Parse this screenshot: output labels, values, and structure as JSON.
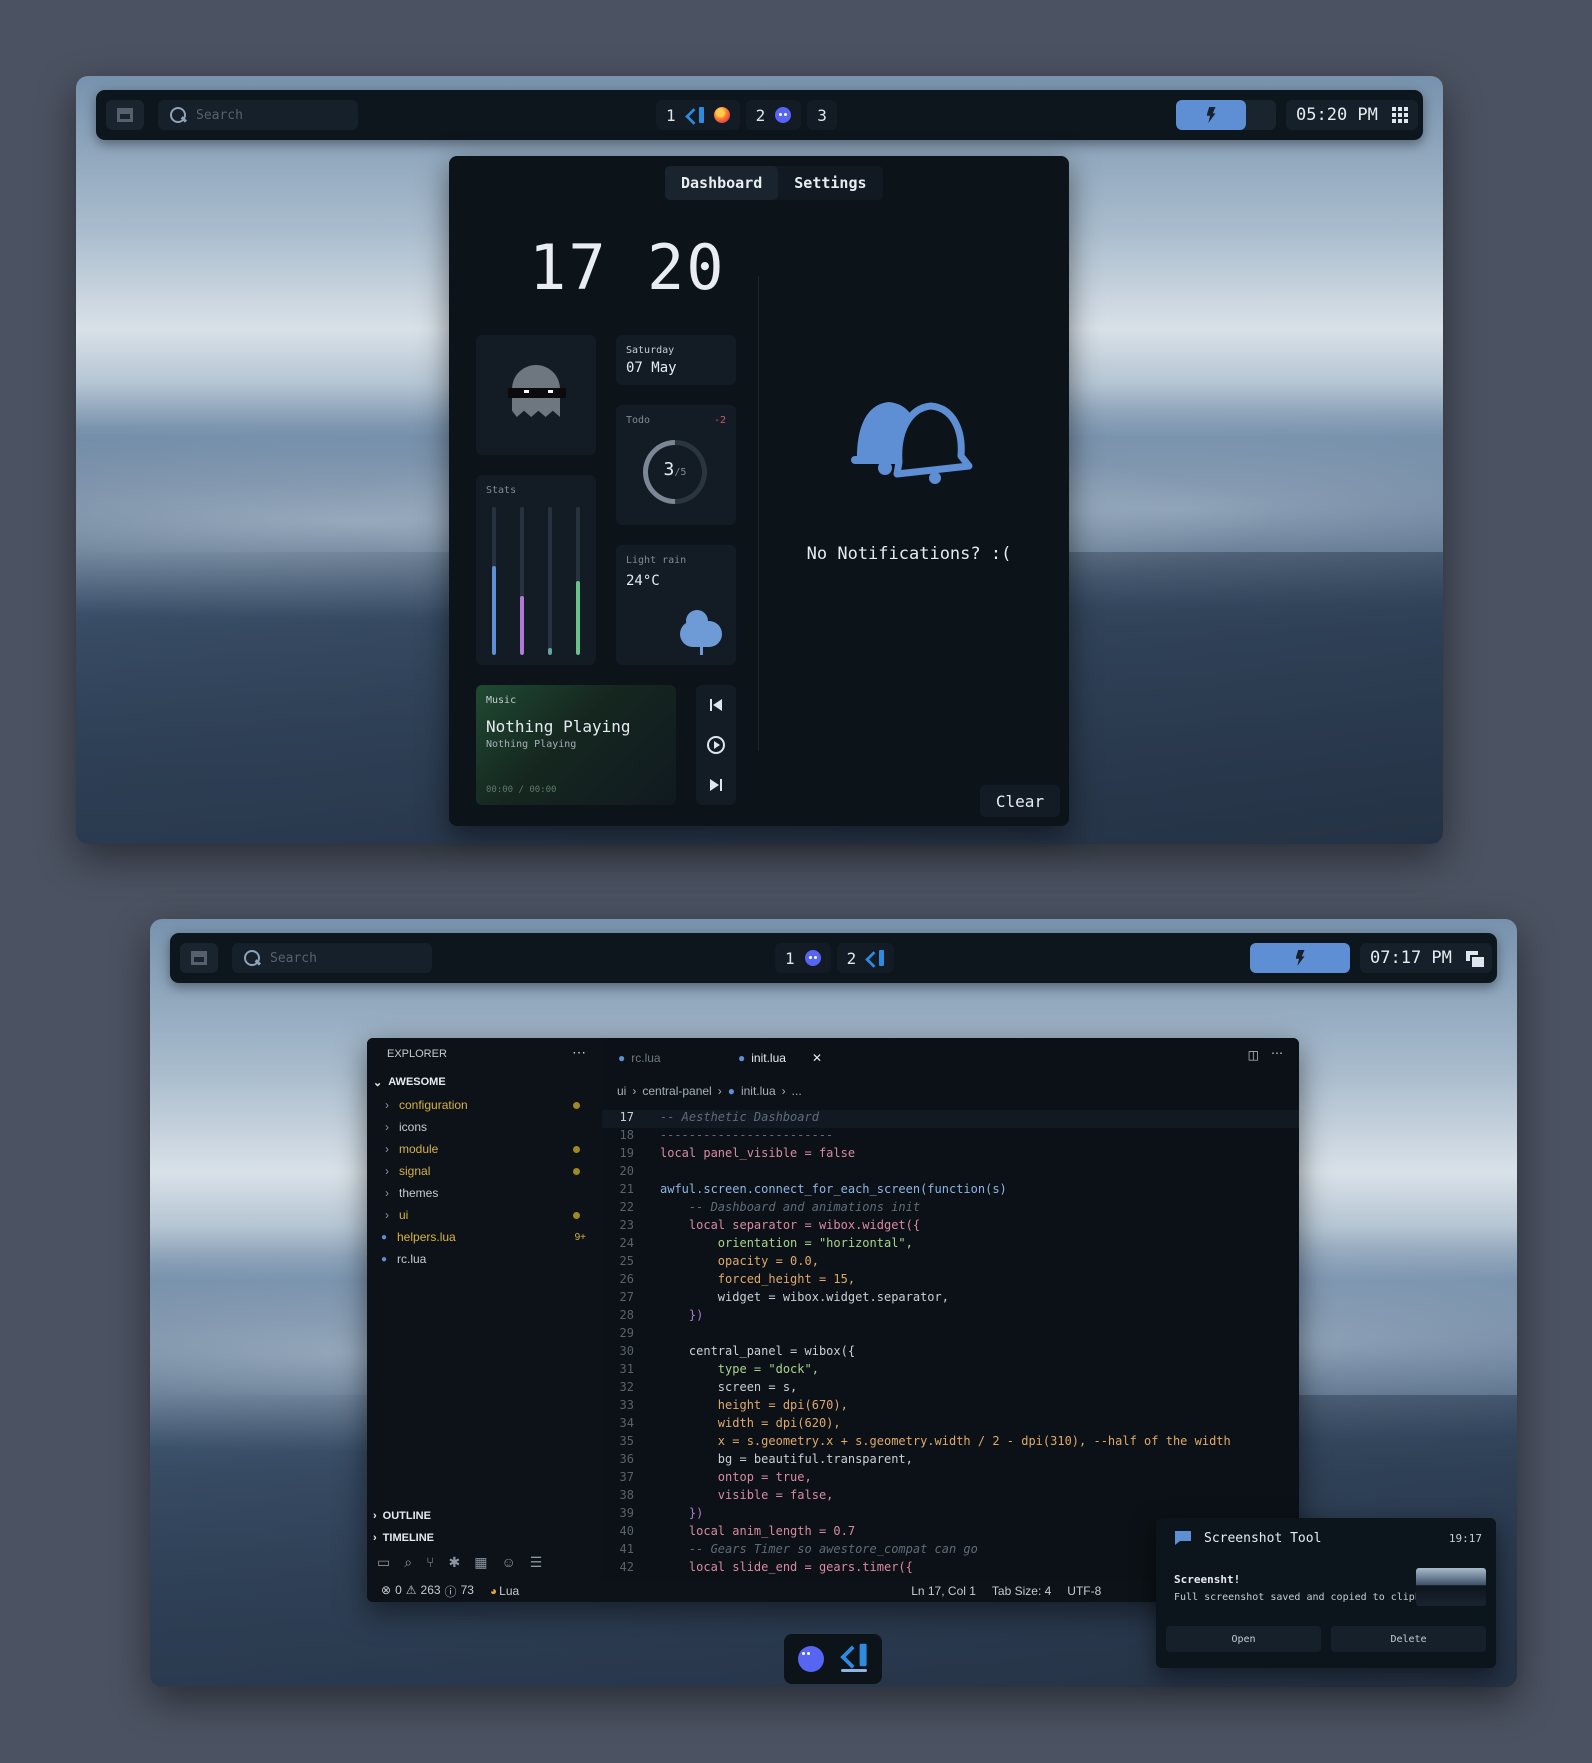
{
  "top": {
    "search_placeholder": "Search",
    "workspaces": [
      {
        "num": "1",
        "apps": [
          "vscode-icon",
          "firefox-icon"
        ]
      },
      {
        "num": "2",
        "apps": [
          "discord-icon"
        ]
      },
      {
        "num": "3",
        "apps": []
      }
    ],
    "time": "05:20 PM",
    "power_level": 0.7,
    "tabs": [
      "Dashboard",
      "Settings"
    ],
    "active_tab": "Dashboard",
    "clock_hours": "17",
    "clock_minutes": "20",
    "date": {
      "day": "Saturday",
      "date": "07 May"
    },
    "todo": {
      "label": "Todo",
      "delta": "-2",
      "done": "3",
      "total": "/5"
    },
    "stats": {
      "label": "Stats",
      "levels": [
        0.6,
        0.4,
        0.05,
        0.5
      ],
      "colors": [
        "#5e8ed4",
        "#b07ad6",
        "#5fa6a0",
        "#6cc08a"
      ]
    },
    "weather": {
      "condition": "Light rain",
      "temp": "24°C"
    },
    "music": {
      "label": "Music",
      "title": "Nothing Playing",
      "artist": "Nothing Playing",
      "time": "00:00 / 00:00"
    },
    "notifications": {
      "empty_text": "No Notifications? :(",
      "clear_label": "Clear"
    }
  },
  "bottom": {
    "search_placeholder": "Search",
    "workspaces": [
      {
        "num": "1",
        "apps": [
          "discord-icon"
        ]
      },
      {
        "num": "2",
        "apps": [
          "vscode-icon"
        ]
      }
    ],
    "time": "07:17 PM",
    "explorer": {
      "title": "EXPLORER",
      "root": "AWESOME",
      "items": [
        {
          "name": "configuration",
          "type": "folder",
          "color": "#d7b240",
          "dot": true
        },
        {
          "name": "icons",
          "type": "folder",
          "color": "#c5cbd3",
          "dot": false
        },
        {
          "name": "module",
          "type": "folder",
          "color": "#d7b240",
          "dot": true
        },
        {
          "name": "signal",
          "type": "folder",
          "color": "#d7b240",
          "dot": true
        },
        {
          "name": "themes",
          "type": "folder",
          "color": "#c5cbd3",
          "dot": false
        },
        {
          "name": "ui",
          "type": "folder",
          "color": "#d7b240",
          "dot": true
        },
        {
          "name": "helpers.lua",
          "type": "file",
          "color": "#d7b240",
          "badge": "9+"
        },
        {
          "name": "rc.lua",
          "type": "file",
          "color": "#c5cbd3",
          "dot": false
        }
      ],
      "outline": "OUTLINE",
      "timeline": "TIMELINE"
    },
    "tabs": [
      {
        "name": "rc.lua",
        "active": false
      },
      {
        "name": "init.lua",
        "active": true
      }
    ],
    "breadcrumb": [
      "ui",
      "central-panel",
      "init.lua",
      "..."
    ],
    "code_lines": [
      {
        "n": "17",
        "t": "-- Aesthetic Dashboard",
        "c": "cm"
      },
      {
        "n": "18",
        "t": "------------------------",
        "c": "cm"
      },
      {
        "n": "19",
        "t": "local panel_visible = false",
        "c": "kw"
      },
      {
        "n": "20",
        "t": "",
        "c": ""
      },
      {
        "n": "21",
        "t": "awful.screen.connect_for_each_screen(function(s)",
        "c": "fn"
      },
      {
        "n": "22",
        "t": "    -- Dashboard and animations init",
        "c": "cm"
      },
      {
        "n": "23",
        "t": "    local separator = wibox.widget({",
        "c": "kw"
      },
      {
        "n": "24",
        "t": "        orientation = \"horizontal\",",
        "c": "st"
      },
      {
        "n": "25",
        "t": "        opacity = 0.0,",
        "c": "nm"
      },
      {
        "n": "26",
        "t": "        forced_height = 15,",
        "c": "nm"
      },
      {
        "n": "27",
        "t": "        widget = wibox.widget.separator,",
        "c": ""
      },
      {
        "n": "28",
        "t": "    })",
        "c": "br"
      },
      {
        "n": "29",
        "t": "",
        "c": ""
      },
      {
        "n": "30",
        "t": "    central_panel = wibox({",
        "c": ""
      },
      {
        "n": "31",
        "t": "        type = \"dock\",",
        "c": "st"
      },
      {
        "n": "32",
        "t": "        screen = s,",
        "c": ""
      },
      {
        "n": "33",
        "t": "        height = dpi(670),",
        "c": "nm"
      },
      {
        "n": "34",
        "t": "        width = dpi(620),",
        "c": "nm"
      },
      {
        "n": "35",
        "t": "        x = s.geometry.x + s.geometry.width / 2 - dpi(310), --half of the width",
        "c": "nm"
      },
      {
        "n": "36",
        "t": "        bg = beautiful.transparent,",
        "c": ""
      },
      {
        "n": "37",
        "t": "        ontop = true,",
        "c": "kw"
      },
      {
        "n": "38",
        "t": "        visible = false,",
        "c": "kw"
      },
      {
        "n": "39",
        "t": "    })",
        "c": "br"
      },
      {
        "n": "40",
        "t": "    local anim_length = 0.7",
        "c": "kw"
      },
      {
        "n": "41",
        "t": "    -- Gears Timer so awestore_compat can go",
        "c": "cm"
      },
      {
        "n": "42",
        "t": "    local slide_end = gears.timer({",
        "c": "kw"
      }
    ],
    "status": {
      "errors": "0",
      "warnings": "263",
      "info": "73",
      "lang": "Lua",
      "position": "Ln 17, Col 1",
      "tab_size": "Tab Size: 4",
      "encoding": "UTF-8"
    },
    "toast": {
      "app": "Screenshot Tool",
      "time": "19:17",
      "title": "Screensht!",
      "body": "Full screenshot saved and copied to clipbo",
      "open": "Open",
      "delete": "Delete"
    }
  }
}
